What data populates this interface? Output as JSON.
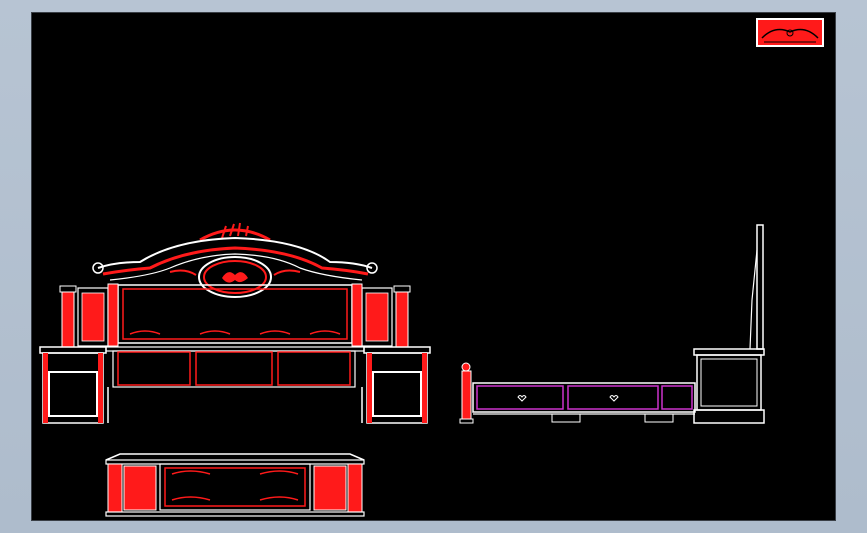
{
  "app": {
    "viewport": "cad-model-space",
    "background": "#000000",
    "frame_color": "#b4c2d1"
  },
  "colors": {
    "outline": "#ffffff",
    "ornament": "#ff1a1a",
    "drawer_line": "#cc33cc",
    "thumb_fill": "#ff1a1a"
  },
  "views": [
    {
      "name": "headboard-front-elevation",
      "icon": "bed-headboard-icon"
    },
    {
      "name": "footboard-front-elevation",
      "icon": "bed-footboard-icon"
    },
    {
      "name": "bed-side-elevation",
      "icon": "bed-side-icon"
    },
    {
      "name": "block-preview-thumbnail",
      "icon": "ornament-thumbnail-icon"
    }
  ]
}
